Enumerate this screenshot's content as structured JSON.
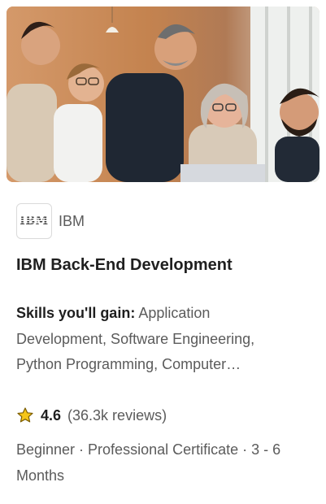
{
  "course": {
    "image_alt": "Group of smiling colleagues",
    "partner": {
      "logo_text": "IBM",
      "name": "IBM"
    },
    "title": "IBM Back-End Development",
    "skills": {
      "label": "Skills you'll gain:",
      "line1_rest": " Application",
      "line2": "Development, Software Engineering,",
      "line3": "Python Programming, Computer…"
    },
    "rating": {
      "icon": "star-icon",
      "value": "4.6",
      "reviews": "(36.3k reviews)"
    },
    "meta": {
      "line1": "Beginner · Professional Certificate · 3 - 6",
      "line2": "Months"
    }
  },
  "colors": {
    "star": "#f5c518",
    "title": "#1f1f1f",
    "secondary": "#5b5b5b"
  }
}
